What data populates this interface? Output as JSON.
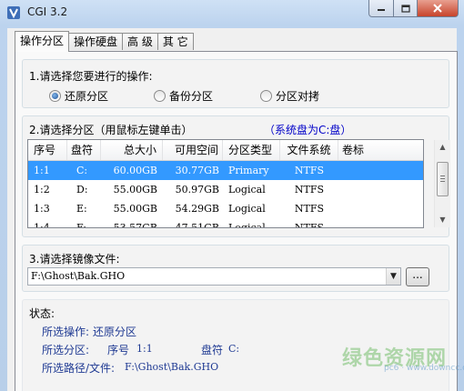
{
  "window": {
    "title": "CGI 3.2"
  },
  "tabs": [
    "操作分区",
    "操作硬盘",
    "高 级",
    "其 它"
  ],
  "operation": {
    "label": "1.请选择您要进行的操作:",
    "options": [
      {
        "label": "还原分区",
        "selected": true
      },
      {
        "label": "备份分区",
        "selected": false
      },
      {
        "label": "分区对拷",
        "selected": false
      }
    ]
  },
  "partition": {
    "label": "2.请选择分区（用鼠标左键单击）",
    "system_note": "（系统盘为C:盘）",
    "columns": [
      "序号",
      "盘符",
      "总大小",
      "可用空间",
      "分区类型",
      "文件系统",
      "卷标"
    ],
    "rows": [
      [
        "1:1",
        "C:",
        "60.00GB",
        "30.77GB",
        "Primary",
        "NTFS",
        ""
      ],
      [
        "1:2",
        "D:",
        "55.00GB",
        "50.97GB",
        "Logical",
        "NTFS",
        ""
      ],
      [
        "1:3",
        "E:",
        "55.00GB",
        "54.29GB",
        "Logical",
        "NTFS",
        ""
      ],
      [
        "1:4",
        "F:",
        "53.57GB",
        "47.51GB",
        "Logical",
        "NTFS",
        ""
      ]
    ],
    "selected_row": 0
  },
  "image": {
    "label": "3.请选择镜像文件:",
    "path": "F:\\Ghost\\Bak.GHO",
    "browse_label": "..."
  },
  "status": {
    "label": "状态:",
    "op_label": "所选操作:",
    "op_value": "还原分区",
    "part_label": "所选分区:",
    "part_no_label": "序号",
    "part_no": "1:1",
    "drive_label": "盘符",
    "drive": "C:",
    "file_label": "所选路径/文件:",
    "file": "F:\\Ghost\\Bak.GHO"
  },
  "watermark": {
    "text": "绿色资源网",
    "site": "pc6 · www.downcc.com"
  },
  "colors": {
    "selection": "#3399ff",
    "status_text": "#1f3a93",
    "note_text": "#0000c8"
  }
}
